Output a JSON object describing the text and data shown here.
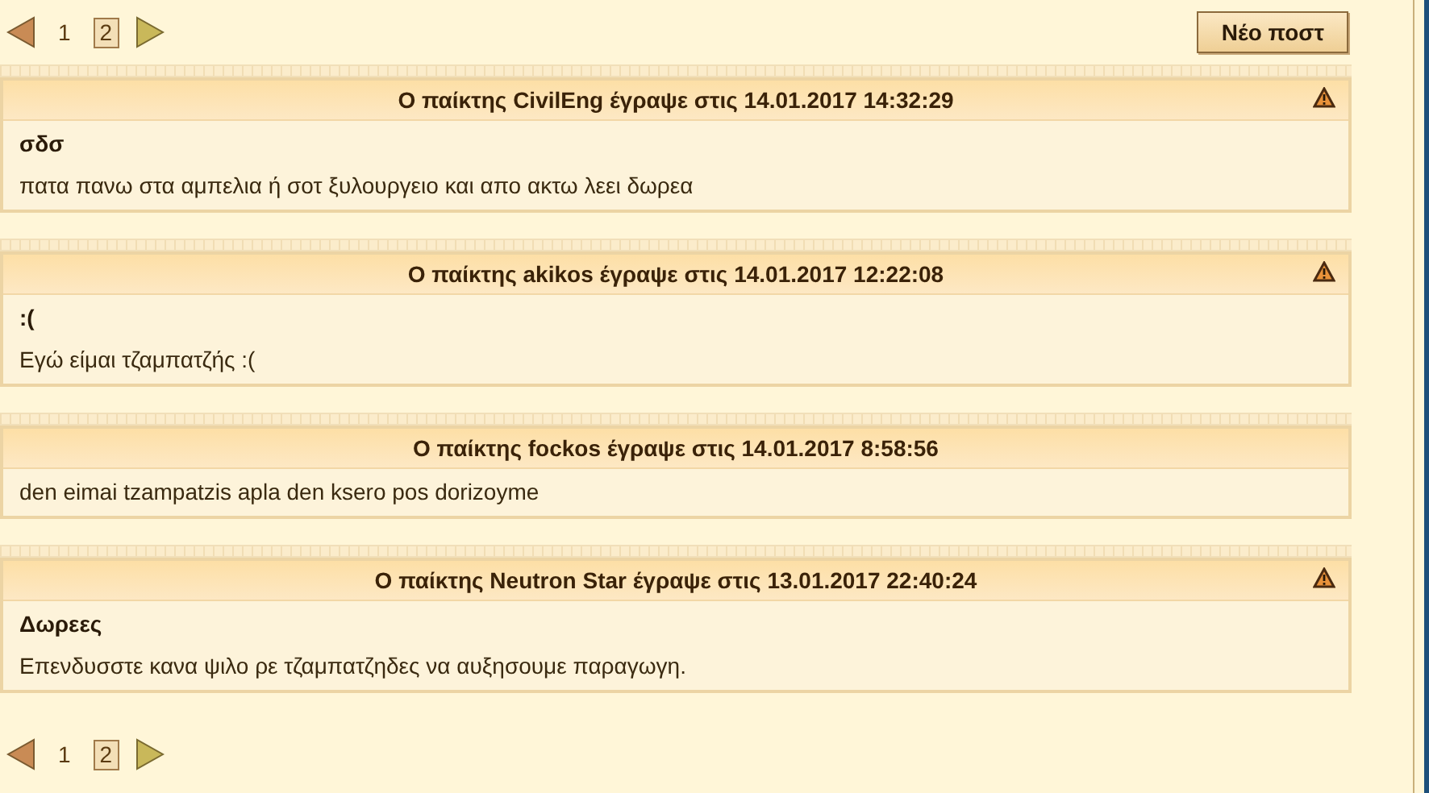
{
  "pagination_top": {
    "pages": [
      {
        "label": "1",
        "selected": false
      },
      {
        "label": "2",
        "selected": true
      }
    ]
  },
  "new_post_button": "Νέο ποστ",
  "posts": [
    {
      "header": "Ο παίκτης CivilEng έγραψε στις 14.01.2017 14:32:29",
      "reportable": true,
      "title": "σδσ",
      "body": "πατα πανω στα αμπελια ή σοτ ξυλουργειο και απο ακτω λεει δωρεα"
    },
    {
      "header": "Ο παίκτης akikos έγραψε στις 14.01.2017 12:22:08",
      "reportable": true,
      "title": ":(",
      "body": "Εγώ είμαι τζαμπατζής :("
    },
    {
      "header": "Ο παίκτης fockos έγραψε στις 14.01.2017 8:58:56",
      "reportable": false,
      "body": "den eimai tzampatzis apla den ksero pos dorizoyme"
    },
    {
      "header": "Ο παίκτης Neutron Star έγραψε στις 13.01.2017 22:40:24",
      "reportable": true,
      "title": "Δωρεες",
      "body": "Επενδυσστε κανα ψιλο ρε τζαμπατζηδες να αυξησουμε παραγωγη."
    }
  ],
  "pagination_bottom": {
    "pages": [
      {
        "label": "1",
        "selected": false
      },
      {
        "label": "2",
        "selected": true
      }
    ]
  }
}
